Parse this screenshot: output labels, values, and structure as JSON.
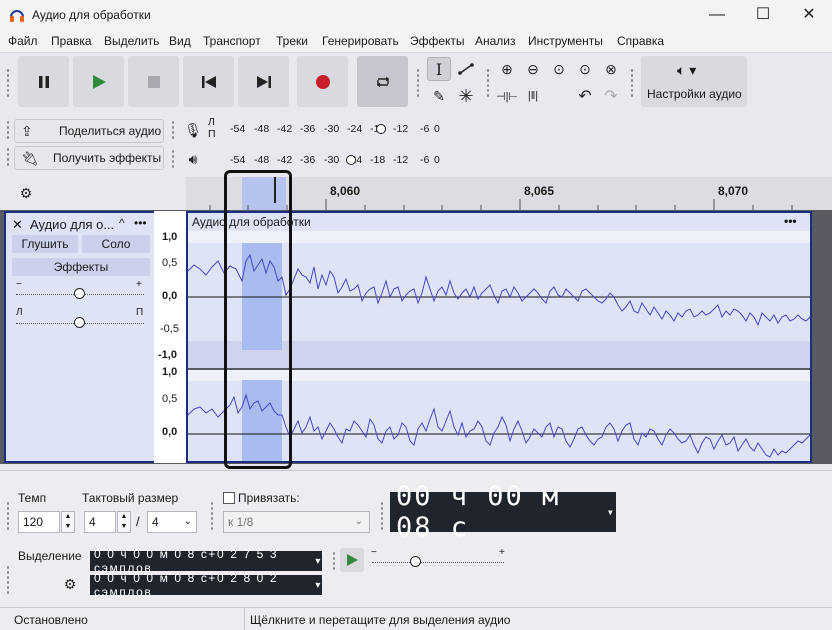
{
  "window": {
    "title": "Аудио для обработки",
    "controls": {
      "minimize": "—",
      "maximize": "☐",
      "close": "✕"
    }
  },
  "menu": [
    "Файл",
    "Правка",
    "Выделить",
    "Вид",
    "Транспорт",
    "Треки",
    "Генерировать",
    "Эффекты",
    "Анализ",
    "Инструменты",
    "Справка"
  ],
  "transport": {
    "pause_icon": "pause-icon",
    "play_icon": "play-icon",
    "stop_icon": "stop-icon",
    "skip_start_icon": "skip-to-start-icon",
    "skip_end_icon": "skip-to-end-icon",
    "record_icon": "record-icon",
    "loop_icon": "loop-icon",
    "play_color": "#2e8b3a",
    "record_color": "#c8202a"
  },
  "audio_setup": {
    "label": "Настройки аудио"
  },
  "share": {
    "label": "Поделиться аудио"
  },
  "get_effects": {
    "label": "Получить эффекты"
  },
  "meters": {
    "record": {
      "channel_top": "Л",
      "channel_bottom": "П",
      "ticks": [
        "-54",
        "-48",
        "-42",
        "-36",
        "-30",
        "-24",
        "-18",
        "-12",
        "-6",
        "0"
      ]
    },
    "playback": {
      "ticks": [
        "-54",
        "-48",
        "-42",
        "-36",
        "-30",
        "-24",
        "-18",
        "-12",
        "-6",
        "0"
      ]
    }
  },
  "ruler": {
    "ticks": [
      "8,060",
      "8,065",
      "8,070"
    ]
  },
  "track": {
    "name": "Аудио для о...",
    "mute": "Глушить",
    "solo": "Соло",
    "effects": "Эффекты",
    "gain_minus": "−",
    "gain_plus": "+",
    "pan_left": "Л",
    "pan_right": "П",
    "clip_title": "Аудио для обработки",
    "clip_menu": "•••",
    "scale_top": [
      "1,0",
      "0,5",
      "0,0",
      "-0,5",
      "-1,0"
    ],
    "scale_bottom": [
      "1,0",
      "0,5",
      "0,0"
    ]
  },
  "bottom": {
    "tempo_label": "Темп",
    "tempo_value": "120",
    "meter_label": "Тактовый размер",
    "meter_num": "4",
    "meter_slash": "/",
    "meter_den": "4",
    "snap_label": "Привязать:",
    "snap_value": "к 1/8",
    "time_display": "00 ч 00 м 08 с",
    "selection_label": "Выделение",
    "sel_start": "0 0 ч 0 0 м 0 8 с+0 2 7 5 3 сэмплов",
    "sel_end": "0 0 ч 0 0 м 0 8 с+0 2 8 0 2 сэмплов",
    "speed_minus": "−",
    "speed_plus": "+"
  },
  "status": {
    "left": "Остановлено",
    "right": "Щёлкните и перетащите для выделения аудио"
  }
}
